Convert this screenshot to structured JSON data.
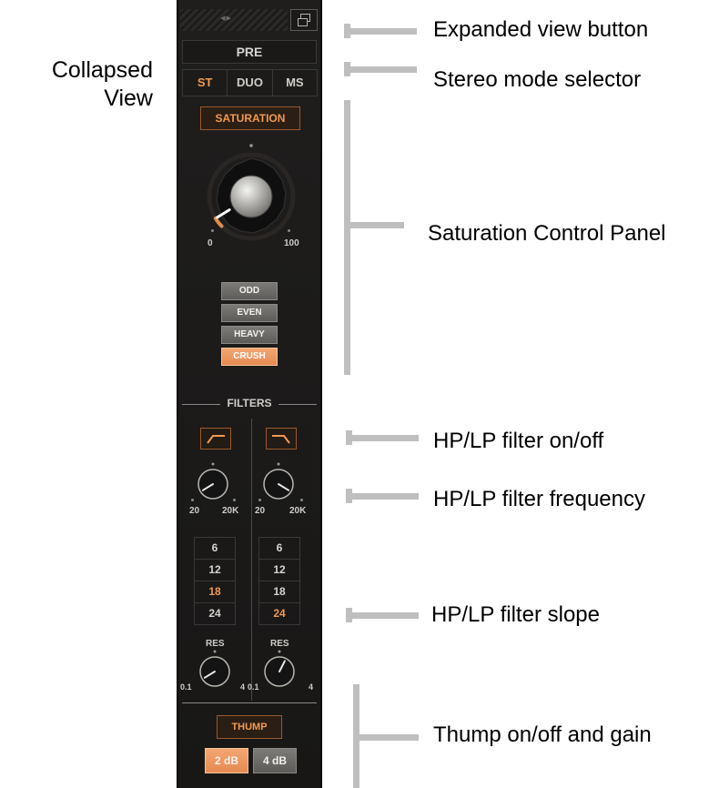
{
  "side_label": {
    "line1": "Collapsed",
    "line2": "View"
  },
  "annotations": {
    "expanded_view": "Expanded view button",
    "stereo_mode": "Stereo mode selector",
    "saturation_panel": "Saturation Control Panel",
    "filter_onoff": "HP/LP filter on/off",
    "filter_frequency": "HP/LP filter frequency",
    "filter_slope": "HP/LP filter slope",
    "thump": "Thump on/off and gain"
  },
  "plugin": {
    "nav_arrows": "◂▸",
    "section_title": "PRE",
    "stereo_modes": [
      {
        "label": "ST",
        "active": true
      },
      {
        "label": "DUO",
        "active": false
      },
      {
        "label": "MS",
        "active": false
      }
    ],
    "saturation": {
      "label": "SATURATION",
      "min_label": "0",
      "max_label": "100",
      "drive_fraction": 0.05,
      "harmonics": [
        {
          "label": "ODD",
          "active": false
        },
        {
          "label": "EVEN",
          "active": false
        },
        {
          "label": "HEAVY",
          "active": false
        },
        {
          "label": "CRUSH",
          "active": true
        }
      ]
    },
    "filters": {
      "title": "FILTERS",
      "hp": {
        "icon": "highpass-icon",
        "freq_min": "20",
        "freq_max": "20K",
        "freq_fraction": 0.05,
        "slopes": [
          "6",
          "12",
          "18",
          "24"
        ],
        "active_slope": "18",
        "res_label": "RES",
        "res_min": "0.1",
        "res_max": "4",
        "res_fraction": 0.05
      },
      "lp": {
        "icon": "lowpass-icon",
        "freq_min": "20",
        "freq_max": "20K",
        "freq_fraction": 0.95,
        "slopes": [
          "6",
          "12",
          "18",
          "24"
        ],
        "active_slope": "24",
        "res_label": "RES",
        "res_min": "0.1",
        "res_max": "4",
        "res_fraction": 0.6
      }
    },
    "thump": {
      "label": "THUMP",
      "gains": [
        {
          "label": "2 dB",
          "active": true
        },
        {
          "label": "4 dB",
          "active": false
        }
      ]
    }
  },
  "colors": {
    "accent": "#f29a4f",
    "panel": "#1d1c1b",
    "annotation_line": "#bfbfbf"
  }
}
